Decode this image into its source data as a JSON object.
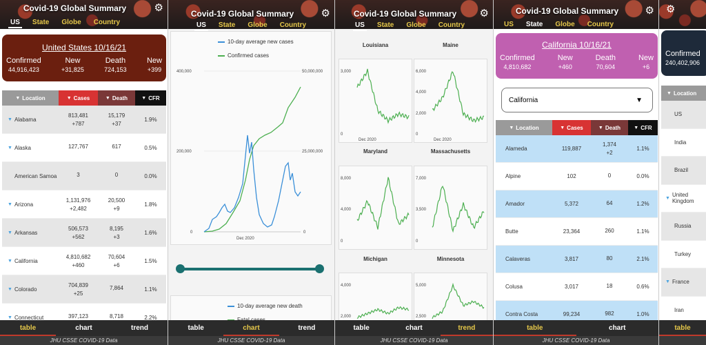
{
  "app_title": "Covid-19 Global Summary",
  "tabs": [
    "US",
    "State",
    "Globe",
    "Country"
  ],
  "bottom_tabs": [
    "table",
    "chart",
    "trend"
  ],
  "footer": "JHU CSSE COVID-19 Data",
  "colors": {
    "us_card": "#6b1f0f",
    "state_card": "#c060b0",
    "globe_card": "#1e2a3a",
    "cases_header": "#d83333",
    "death_header": "#7a3838",
    "cfr_header": "#111111",
    "location_header": "#9a9a9a",
    "chart_green": "#4caf50",
    "chart_blue": "#3a8fd8",
    "slider": "#1a7070"
  },
  "us_summary": {
    "title": "United States 10/16/21",
    "confirmed_label": "Confirmed",
    "confirmed": "44,916,423",
    "new_label": "New",
    "new": "+31,825",
    "death_label": "Death",
    "death": "724,153",
    "new2_label": "New",
    "new2": "+399"
  },
  "us_table": {
    "headers": [
      "Location",
      "Cases",
      "Death",
      "CFR"
    ],
    "rows": [
      {
        "loc": "Alabama",
        "cases": "813,481",
        "cases_new": "+787",
        "death": "15,179",
        "death_new": "+37",
        "cfr": "1.9%"
      },
      {
        "loc": "Alaska",
        "cases": "127,767",
        "cases_new": "",
        "death": "617",
        "death_new": "",
        "cfr": "0.5%"
      },
      {
        "loc": "American Samoa",
        "cases": "3",
        "cases_new": "",
        "death": "0",
        "death_new": "",
        "cfr": "0.0%"
      },
      {
        "loc": "Arizona",
        "cases": "1,131,976",
        "cases_new": "+2,482",
        "death": "20,500",
        "death_new": "+9",
        "cfr": "1.8%"
      },
      {
        "loc": "Arkansas",
        "cases": "506,573",
        "cases_new": "+562",
        "death": "8,195",
        "death_new": "+3",
        "cfr": "1.6%"
      },
      {
        "loc": "California",
        "cases": "4,810,682",
        "cases_new": "+460",
        "death": "70,604",
        "death_new": "+6",
        "cfr": "1.5%"
      },
      {
        "loc": "Colorado",
        "cases": "704,839",
        "cases_new": "+25",
        "death": "7,864",
        "death_new": "",
        "cfr": "1.1%"
      },
      {
        "loc": "Connecticut",
        "cases": "397,123",
        "cases_new": "",
        "death": "8,718",
        "death_new": "",
        "cfr": "2.2%"
      }
    ]
  },
  "chart_data": [
    {
      "type": "line",
      "series": [
        {
          "name": "10-day average new cases"
        },
        {
          "name": "Confirmed cases"
        }
      ],
      "left_ticks": [
        "400,000",
        "200,000",
        "0"
      ],
      "right_ticks": [
        "50,000,000",
        "25,000,000",
        "0"
      ],
      "xlabel": "Dec 2020"
    },
    {
      "type": "line",
      "series": [
        {
          "name": "10-day average new death"
        },
        {
          "name": "Fatal cases"
        }
      ]
    },
    {
      "type": "line",
      "title": "Louisiana"
    },
    {
      "type": "line",
      "title": "Maine"
    },
    {
      "type": "line",
      "title": "Maryland",
      "ticks": [
        "3,000",
        "0"
      ],
      "xlabel": "Dec 2020"
    },
    {
      "type": "line",
      "title": "Massachusetts",
      "ticks": [
        "6,000",
        "4,000",
        "2,000",
        "0"
      ],
      "xlabel": "Dec 2020"
    },
    {
      "type": "line",
      "title": "Michigan",
      "ticks": [
        "8,000",
        "4,000",
        "0"
      ]
    },
    {
      "type": "line",
      "title": "Minnesota",
      "ticks": [
        "7,000",
        "3,500",
        "0"
      ]
    },
    {
      "type": "line",
      "ticks": [
        "4,000",
        "2,000"
      ]
    },
    {
      "type": "line",
      "ticks": [
        "5,000",
        "2,500"
      ]
    }
  ],
  "ca_summary": {
    "title": "California 10/16/21",
    "confirmed_label": "Confirmed",
    "confirmed": "4,810,682",
    "new_label": "New",
    "new": "+460",
    "death_label": "Death",
    "death": "70,604",
    "new2_label": "New",
    "new2": "+6"
  },
  "state_select": {
    "value": "California"
  },
  "ca_table": {
    "headers": [
      "Location",
      "Cases",
      "Death",
      "CFR"
    ],
    "rows": [
      {
        "loc": "Alameda",
        "cases": "119,887",
        "death": "1,374",
        "death_new": "+2",
        "cfr": "1.1%"
      },
      {
        "loc": "Alpine",
        "cases": "102",
        "death": "0",
        "death_new": "",
        "cfr": "0.0%"
      },
      {
        "loc": "Amador",
        "cases": "5,372",
        "death": "64",
        "death_new": "",
        "cfr": "1.2%"
      },
      {
        "loc": "Butte",
        "cases": "23,364",
        "death": "260",
        "death_new": "",
        "cfr": "1.1%"
      },
      {
        "loc": "Calaveras",
        "cases": "3,817",
        "death": "80",
        "death_new": "",
        "cfr": "2.1%"
      },
      {
        "loc": "Colusa",
        "cases": "3,017",
        "death": "18",
        "death_new": "",
        "cfr": "0.6%"
      },
      {
        "loc": "Contra Costa",
        "cases": "99,234",
        "death": "982",
        "death_new": "",
        "cfr": "1.0%"
      }
    ]
  },
  "globe_summary": {
    "confirmed_label": "Confirmed",
    "confirmed": "240,402,906"
  },
  "globe_table": {
    "header": "Location",
    "rows": [
      "US",
      "India",
      "Brazil",
      "United Kingdom",
      "Russia",
      "Turkey",
      "France",
      "Iran"
    ]
  }
}
